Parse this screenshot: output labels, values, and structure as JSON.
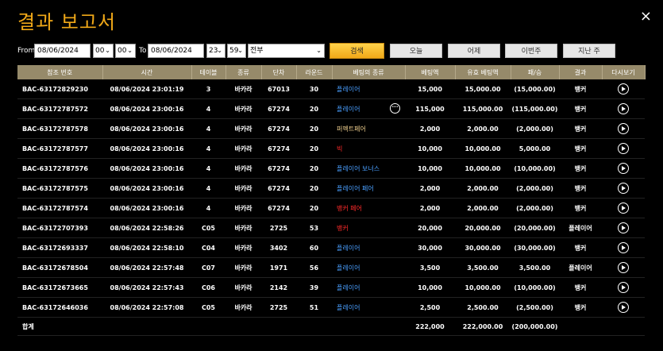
{
  "title": "결과 보고서",
  "close_label": "×",
  "filter": {
    "from_label": "From",
    "from_date": "08/06/2024",
    "from_hour": "00",
    "from_min": "00",
    "to_label": "To",
    "to_date": "08/06/2024",
    "to_hour": "23",
    "to_min": "59",
    "type": "전부",
    "search_label": "검색",
    "quick": [
      "오늘",
      "어제",
      "이번주",
      "지난 주"
    ]
  },
  "columns": [
    "참조 번호",
    "시간",
    "테이블",
    "종류",
    "단차",
    "라운드",
    "베팅의 종류",
    "베팅액",
    "유효 베팅액",
    "패/승",
    "결과",
    "다시보기"
  ],
  "rows": [
    {
      "ref": "BAC-63172829230",
      "time": "08/06/2024 23:01:19",
      "table": "3",
      "kind": "바카라",
      "shoe": "67013",
      "round": "30",
      "bet": "플레이어",
      "bet_type": "player",
      "amount": "15,000",
      "valid": "15,000.00",
      "winloss": "(15,000.00)",
      "neg": true,
      "result": "뱅커",
      "result_type": "banker",
      "more": false
    },
    {
      "ref": "BAC-63172787572",
      "time": "08/06/2024 23:00:16",
      "table": "4",
      "kind": "바카라",
      "shoe": "67274",
      "round": "20",
      "bet": "플레이어",
      "bet_type": "player",
      "amount": "115,000",
      "valid": "115,000.00",
      "winloss": "(115,000.00)",
      "neg": true,
      "result": "뱅커",
      "result_type": "banker",
      "more": true
    },
    {
      "ref": "BAC-63172787578",
      "time": "08/06/2024 23:00:16",
      "table": "4",
      "kind": "바카라",
      "shoe": "67274",
      "round": "20",
      "bet": "퍼펙트페어",
      "bet_type": "perfect",
      "amount": "2,000",
      "valid": "2,000.00",
      "winloss": "(2,000.00)",
      "neg": true,
      "result": "뱅커",
      "result_type": "banker",
      "more": false
    },
    {
      "ref": "BAC-63172787577",
      "time": "08/06/2024 23:00:16",
      "table": "4",
      "kind": "바카라",
      "shoe": "67274",
      "round": "20",
      "bet": "빅",
      "bet_type": "big",
      "amount": "10,000",
      "valid": "10,000.00",
      "winloss": "5,000.00",
      "neg": false,
      "result": "뱅커",
      "result_type": "banker",
      "more": false
    },
    {
      "ref": "BAC-63172787576",
      "time": "08/06/2024 23:00:16",
      "table": "4",
      "kind": "바카라",
      "shoe": "67274",
      "round": "20",
      "bet": "플레이어 보너스",
      "bet_type": "player",
      "amount": "10,000",
      "valid": "10,000.00",
      "winloss": "(10,000.00)",
      "neg": true,
      "result": "뱅커",
      "result_type": "banker",
      "more": false
    },
    {
      "ref": "BAC-63172787575",
      "time": "08/06/2024 23:00:16",
      "table": "4",
      "kind": "바카라",
      "shoe": "67274",
      "round": "20",
      "bet": "플레이어 페어",
      "bet_type": "player",
      "amount": "2,000",
      "valid": "2,000.00",
      "winloss": "(2,000.00)",
      "neg": true,
      "result": "뱅커",
      "result_type": "banker",
      "more": false
    },
    {
      "ref": "BAC-63172787574",
      "time": "08/06/2024 23:00:16",
      "table": "4",
      "kind": "바카라",
      "shoe": "67274",
      "round": "20",
      "bet": "뱅커 페어",
      "bet_type": "banker",
      "amount": "2,000",
      "valid": "2,000.00",
      "winloss": "(2,000.00)",
      "neg": true,
      "result": "뱅커",
      "result_type": "banker",
      "more": false
    },
    {
      "ref": "BAC-63172707393",
      "time": "08/06/2024 22:58:26",
      "table": "C05",
      "kind": "바카라",
      "shoe": "2725",
      "round": "53",
      "bet": "뱅커",
      "bet_type": "banker",
      "amount": "20,000",
      "valid": "20,000.00",
      "winloss": "(20,000.00)",
      "neg": true,
      "result": "플레이어",
      "result_type": "player",
      "more": false
    },
    {
      "ref": "BAC-63172693337",
      "time": "08/06/2024 22:58:10",
      "table": "C04",
      "kind": "바카라",
      "shoe": "3402",
      "round": "60",
      "bet": "플레이어",
      "bet_type": "player",
      "amount": "30,000",
      "valid": "30,000.00",
      "winloss": "(30,000.00)",
      "neg": true,
      "result": "뱅커",
      "result_type": "banker",
      "more": false
    },
    {
      "ref": "BAC-63172678504",
      "time": "08/06/2024 22:57:48",
      "table": "C07",
      "kind": "바카라",
      "shoe": "1971",
      "round": "56",
      "bet": "플레이어",
      "bet_type": "player",
      "amount": "3,500",
      "valid": "3,500.00",
      "winloss": "3,500.00",
      "neg": false,
      "result": "플레이어",
      "result_type": "player",
      "more": false
    },
    {
      "ref": "BAC-63172673665",
      "time": "08/06/2024 22:57:43",
      "table": "C06",
      "kind": "바카라",
      "shoe": "2142",
      "round": "39",
      "bet": "플레이어",
      "bet_type": "player",
      "amount": "10,000",
      "valid": "10,000.00",
      "winloss": "(10,000.00)",
      "neg": true,
      "result": "뱅커",
      "result_type": "banker",
      "more": false
    },
    {
      "ref": "BAC-63172646036",
      "time": "08/06/2024 22:57:08",
      "table": "C05",
      "kind": "바카라",
      "shoe": "2725",
      "round": "51",
      "bet": "플레이어",
      "bet_type": "player",
      "amount": "2,500",
      "valid": "2,500.00",
      "winloss": "(2,500.00)",
      "neg": true,
      "result": "뱅커",
      "result_type": "banker",
      "more": false
    }
  ],
  "total": {
    "label": "합계",
    "amount": "222,000",
    "valid": "222,000.00",
    "winloss": "(200,000.00)"
  },
  "more_icon_glyph": "···",
  "colors": {
    "accent": "#f0a818",
    "player": "#4a9fff",
    "banker": "#ff2a2a",
    "header_bg": "#968a6a"
  }
}
